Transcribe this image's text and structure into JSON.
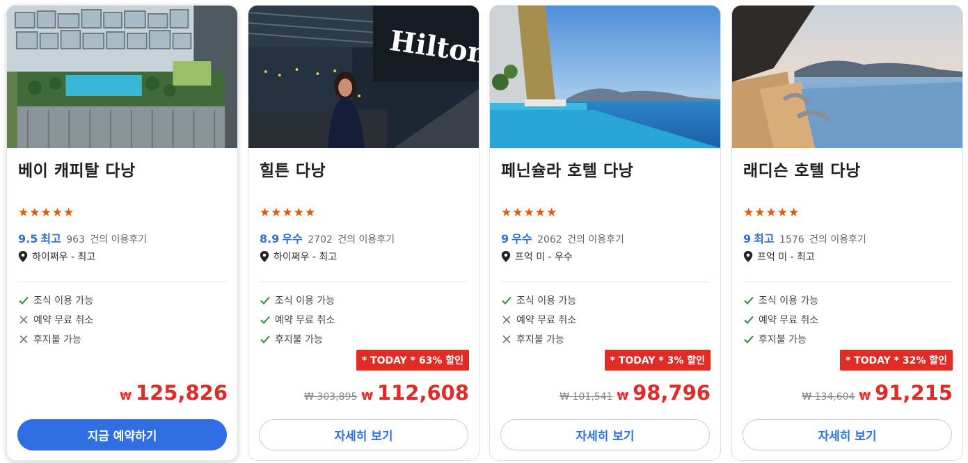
{
  "colors": {
    "brand_blue": "#2f6fe3",
    "rating_blue": "#2f6fd6",
    "star_orange": "#e0590b",
    "price_red": "#e02b27",
    "check_green": "#2e8b3e",
    "cross_gray": "#777777"
  },
  "cards": [
    {
      "name": "베이 캐피탈 다낭",
      "stars": "★★★★★",
      "rating_score": "9.5",
      "rating_grade": "최고",
      "review_count": "963",
      "review_suffix": "건의 이용후기",
      "location": "하이쩌우 - 최고",
      "amenities": [
        {
          "label": "조식 이용 가능",
          "icon": "check-icon",
          "available": true
        },
        {
          "label": "예약 무료 취소",
          "icon": "cross-icon",
          "available": false
        },
        {
          "label": "후지불 가능",
          "icon": "cross-icon",
          "available": false
        }
      ],
      "currency": "₩",
      "price": "125,826",
      "button_label": "지금 예약하기",
      "button_style": "primary"
    },
    {
      "name": "힐튼 다낭",
      "stars": "★★★★★",
      "rating_score": "8.9",
      "rating_grade": "우수",
      "review_count": "2702",
      "review_suffix": "건의 이용후기",
      "location": "하이쩌우 - 최고",
      "amenities": [
        {
          "label": "조식 이용 가능",
          "icon": "check-icon",
          "available": true
        },
        {
          "label": "예약 무료 취소",
          "icon": "check-icon",
          "available": true
        },
        {
          "label": "후지불 가능",
          "icon": "check-icon",
          "available": true
        }
      ],
      "badge": "* TODAY * 63% 할인",
      "original_price": "₩ 303,895",
      "currency": "₩",
      "price": "112,608",
      "button_label": "자세히 보기",
      "button_style": "secondary"
    },
    {
      "name": "페닌슐라 호텔 다낭",
      "stars": "★★★★★",
      "rating_score": "9",
      "rating_grade": "우수",
      "review_count": "2062",
      "review_suffix": "건의 이용후기",
      "location": "프억 미 - 우수",
      "amenities": [
        {
          "label": "조식 이용 가능",
          "icon": "check-icon",
          "available": true
        },
        {
          "label": "예약 무료 취소",
          "icon": "cross-icon",
          "available": false
        },
        {
          "label": "후지불 가능",
          "icon": "cross-icon",
          "available": false
        }
      ],
      "badge": "* TODAY * 3% 할인",
      "original_price": "₩ 101,541",
      "currency": "₩",
      "price": "98,796",
      "button_label": "자세히 보기",
      "button_style": "secondary"
    },
    {
      "name": "래디슨 호텔 다낭",
      "stars": "★★★★★",
      "rating_score": "9",
      "rating_grade": "최고",
      "review_count": "1576",
      "review_suffix": "건의 이용후기",
      "location": "프억 미 - 최고",
      "amenities": [
        {
          "label": "조식 이용 가능",
          "icon": "check-icon",
          "available": true
        },
        {
          "label": "예약 무료 취소",
          "icon": "check-icon",
          "available": true
        },
        {
          "label": "후지불 가능",
          "icon": "check-icon",
          "available": true
        }
      ],
      "badge": "* TODAY * 32% 할인",
      "original_price": "₩ 134,604",
      "currency": "₩",
      "price": "91,215",
      "button_label": "자세히 보기",
      "button_style": "secondary"
    }
  ]
}
